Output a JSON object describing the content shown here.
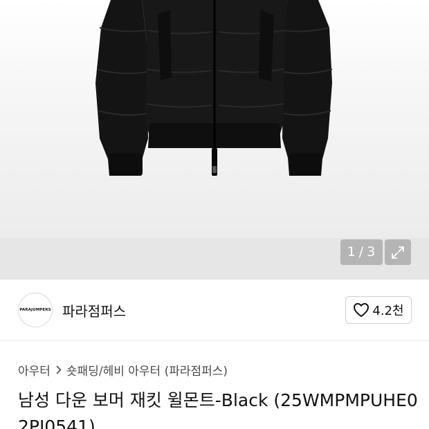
{
  "gallery": {
    "current_page": "1",
    "separator": "/",
    "total_pages": "3",
    "expand_icon": "expand-icon",
    "image_subject": "black-down-bomber-jacket"
  },
  "brand": {
    "logo_text": "PARAJUMPERS",
    "name": "파라점퍼스",
    "like_icon": "heart-icon",
    "like_count": "4.2천"
  },
  "breadcrumb": {
    "level1": "아우터",
    "chevron_icon": "chevron-right-icon",
    "level2": "숏패딩/헤비 아우터 (파라점퍼스)"
  },
  "product": {
    "title": "남성 다운 보머 재킷 윌몬트-Black (25WMPMPUHE02PJ0541)"
  },
  "colors": {
    "gallery_bg": "#e6e6e6",
    "jacket": "#111111",
    "text_primary": "#111111",
    "text_secondary": "#4a4a4a"
  }
}
